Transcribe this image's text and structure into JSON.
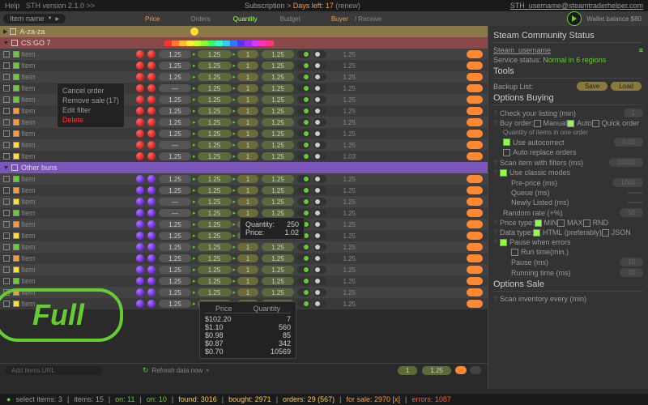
{
  "topbar": {
    "help": "Help",
    "version": "STH version 2.1.0 >>",
    "sub": "Subscription >",
    "days": "Days left: 17",
    "renew": "(renew)",
    "email": "STH_username@steamtraderhelper.com"
  },
  "header": {
    "dropdown": "Item name",
    "price": "Price",
    "orders": "Orders",
    "quantity": "Quantity",
    "budget": "Budget",
    "buyer": "Buyer",
    "receive": "/ Receive",
    "wallet": "Wallet balance $80"
  },
  "groups": {
    "g1": "A-za-za",
    "g2": "CS:GO 7",
    "g3": "Other buns"
  },
  "item_label": "Item",
  "cells": {
    "p1": "1.25",
    "dash": "—",
    "p2": "1.25",
    "p3": "1",
    "p4": "1.25",
    "val": "1.25",
    "val2": "1.03",
    "filter": "filter"
  },
  "ctx1": {
    "a": "Cancel order",
    "b": "Remove sale",
    "bn": "(17)",
    "c": "Edit filter",
    "d": "Delete"
  },
  "ctx2": {
    "q": "Quantity:",
    "qv": "250",
    "p": "Price:",
    "pv": "1.02"
  },
  "ctx3": {
    "h1": "Price",
    "h2": "Quantity",
    "rows": [
      [
        "$102.20",
        "7"
      ],
      [
        "$1.10",
        "560"
      ],
      [
        "$0.98",
        "85"
      ],
      [
        "$0.87",
        "342"
      ],
      [
        "$0.70",
        "10569"
      ]
    ]
  },
  "full": "Full",
  "bottom": {
    "add": "Add items URL",
    "refresh": "Refresh data now",
    "b1": "1",
    "b2": "1.25"
  },
  "status": {
    "sel": "select items: 3",
    "items": "items: 15",
    "on": "on: 11",
    "on2": "on: 10",
    "found": "found: 3016",
    "bought": "bought: 2971",
    "orders": "orders: 29 (567)",
    "sale": "for sale: 2970 [x]",
    "err": "errors: 1087"
  },
  "right": {
    "scs_title": "Steam Community Status",
    "user": "Steam_username",
    "serv": "Service status:",
    "serv_v": "Normal in 6 regions",
    "tools": "Tools",
    "backup": "Backup List:",
    "save": "Save",
    "load": "Load",
    "opt_buy": "Options Buying",
    "check": "Check your listing (min)",
    "buyorder": "Buy order:",
    "manual": "Manual",
    "auto": "Auto",
    "quick": "Quick order",
    "qty": "Quantity of items in one order",
    "autoc": "Use autocorrect",
    "autor": "Auto replace orders",
    "scan": "Scan item with filters (ms)",
    "scan_v": "10000",
    "classic": "Use classic modes",
    "prep": "Pre-price (ms)",
    "prep_v": "1000",
    "queue": "Queue (ms)",
    "newly": "Newly Listed (ms)",
    "random": "Random rate (+%)",
    "random_v": "50",
    "ptype": "Price type:",
    "min": "MIN",
    "max": "MAX",
    "rnd": "RND",
    "dtype": "Data type:",
    "html": "HTML (preferably)",
    "json": "JSON",
    "pause": "Pause when errors",
    "runtime": "Run time(min.)",
    "pauselbl": "Pause (ms)",
    "pausev": "10",
    "runningtime": "Running time (ms)",
    "runningv": "30",
    "opt_sale": "Options Sale",
    "scaninv": "Scan inventory every (min)"
  },
  "palette": [
    "#ff3333",
    "#ff7733",
    "#ffbb33",
    "#ffee33",
    "#ccff33",
    "#88ff33",
    "#33ff66",
    "#33ffcc",
    "#33ccff",
    "#3377ff",
    "#5533ff",
    "#9933ff",
    "#dd33ff",
    "#ff33bb",
    "#ff3377"
  ]
}
